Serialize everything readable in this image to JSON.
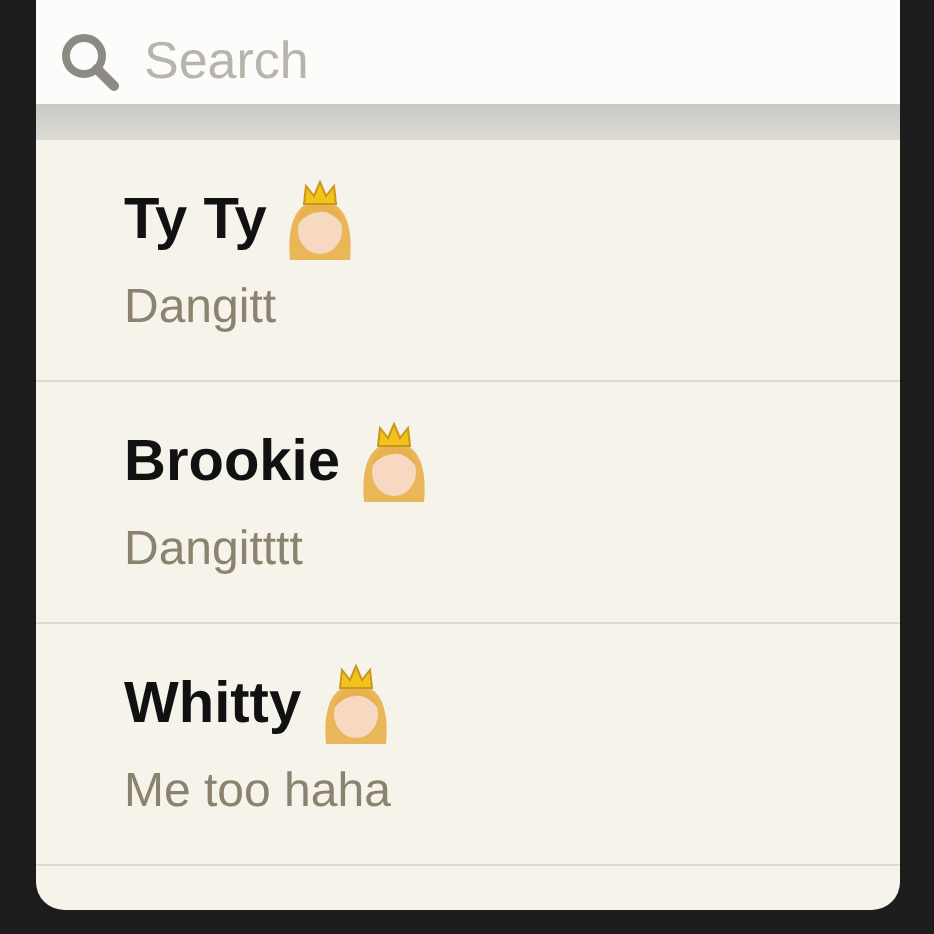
{
  "search": {
    "placeholder": "Search"
  },
  "conversations": [
    {
      "name": "Ty Ty",
      "message": "Dangitt"
    },
    {
      "name": "Brookie",
      "message": "Dangitttt"
    },
    {
      "name": "Whitty",
      "message": "Me too haha"
    }
  ]
}
